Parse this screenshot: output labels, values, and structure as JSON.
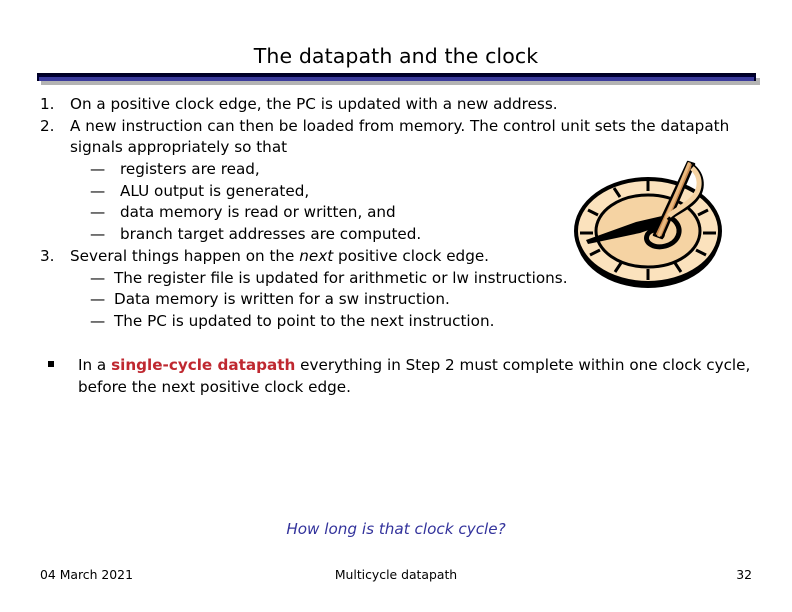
{
  "slide": {
    "title": "The datapath and the clock",
    "accent_color": "#3b3b9c",
    "rule_dark_color": "#000033",
    "highlight_red": "#bf2830",
    "question_color": "#33339c"
  },
  "content": {
    "numbered": [
      {
        "marker": "1.",
        "text": "On a positive clock edge, the PC is updated with a new address."
      },
      {
        "marker": "2.",
        "text": "A new instruction can then be loaded from memory. The control unit sets the datapath signals appropriately so that"
      },
      {
        "marker": "3.",
        "text_before": "Several things happen on the ",
        "text_italic": "next",
        "text_after": " positive clock edge."
      }
    ],
    "sub_items_2": [
      {
        "marker": "—",
        "text": "registers are read,"
      },
      {
        "marker": "—",
        "text": "ALU output is generated,"
      },
      {
        "marker": "—",
        "text": "data memory is read or written, and"
      },
      {
        "marker": "—",
        "text": "branch target addresses are computed."
      }
    ],
    "sub_items_3": [
      {
        "marker": "—",
        "text": "The register file is updated for arithmetic or lw instructions."
      },
      {
        "marker": "—",
        "text": "Data memory is written for a sw instruction."
      },
      {
        "marker": "—",
        "text": "The PC is updated to point to the next instruction."
      }
    ],
    "note": {
      "bullet": "§",
      "text_before": "In a ",
      "text_highlight": "single-cycle datapath",
      "text_after": " everything in Step 2 must complete within one clock cycle, before the next positive clock edge."
    },
    "question": "How long is that clock cycle?"
  },
  "footer": {
    "date": "04 March 2021",
    "subject": "Multicycle datapath",
    "page_number": "32"
  },
  "graphic": {
    "name": "sundial-clipart",
    "face_color": "#fbe2bd",
    "face_shade_color": "#f5d3a3",
    "gnomon_color": "#c98a50",
    "outline_color": "#000000"
  }
}
